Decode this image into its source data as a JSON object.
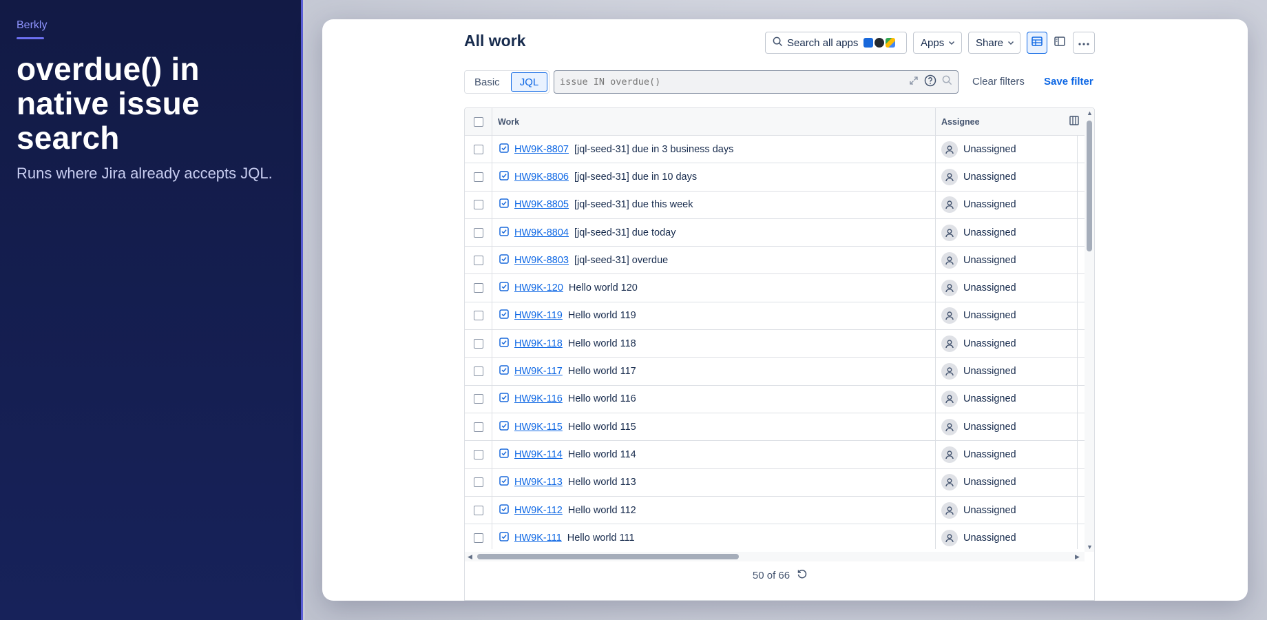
{
  "promo": {
    "brand": "Berkly",
    "headline": "overdue() in native issue search",
    "subhead": "Runs where Jira already accepts JQL."
  },
  "header": {
    "title": "All work",
    "search_apps_label": "Search all apps",
    "apps_label": "Apps",
    "share_label": "Share"
  },
  "filters": {
    "mode_basic": "Basic",
    "mode_jql": "JQL",
    "jql_placeholder": "issue IN overdue()",
    "clear_label": "Clear filters",
    "save_label": "Save filter"
  },
  "table": {
    "col_work": "Work",
    "col_assignee": "Assignee",
    "rows": [
      {
        "key": "HW9K-8807",
        "summary": "[jql-seed-31] due in 3 business days",
        "assignee": "Unassigned"
      },
      {
        "key": "HW9K-8806",
        "summary": "[jql-seed-31] due in 10 days",
        "assignee": "Unassigned"
      },
      {
        "key": "HW9K-8805",
        "summary": "[jql-seed-31] due this week",
        "assignee": "Unassigned"
      },
      {
        "key": "HW9K-8804",
        "summary": "[jql-seed-31] due today",
        "assignee": "Unassigned"
      },
      {
        "key": "HW9K-8803",
        "summary": "[jql-seed-31] overdue",
        "assignee": "Unassigned"
      },
      {
        "key": "HW9K-120",
        "summary": "Hello world 120",
        "assignee": "Unassigned"
      },
      {
        "key": "HW9K-119",
        "summary": "Hello world 119",
        "assignee": "Unassigned"
      },
      {
        "key": "HW9K-118",
        "summary": "Hello world 118",
        "assignee": "Unassigned"
      },
      {
        "key": "HW9K-117",
        "summary": "Hello world 117",
        "assignee": "Unassigned"
      },
      {
        "key": "HW9K-116",
        "summary": "Hello world 116",
        "assignee": "Unassigned"
      },
      {
        "key": "HW9K-115",
        "summary": "Hello world 115",
        "assignee": "Unassigned"
      },
      {
        "key": "HW9K-114",
        "summary": "Hello world 114",
        "assignee": "Unassigned"
      },
      {
        "key": "HW9K-113",
        "summary": "Hello world 113",
        "assignee": "Unassigned"
      },
      {
        "key": "HW9K-112",
        "summary": "Hello world 112",
        "assignee": "Unassigned"
      },
      {
        "key": "HW9K-111",
        "summary": "Hello world 111",
        "assignee": "Unassigned"
      }
    ]
  },
  "pagination": {
    "text": "50 of 66"
  },
  "colors": {
    "link": "#0c66e4",
    "sidebar_bg": "#121a45",
    "brand_accent": "#8f95ff",
    "task_icon": "#1868db"
  }
}
